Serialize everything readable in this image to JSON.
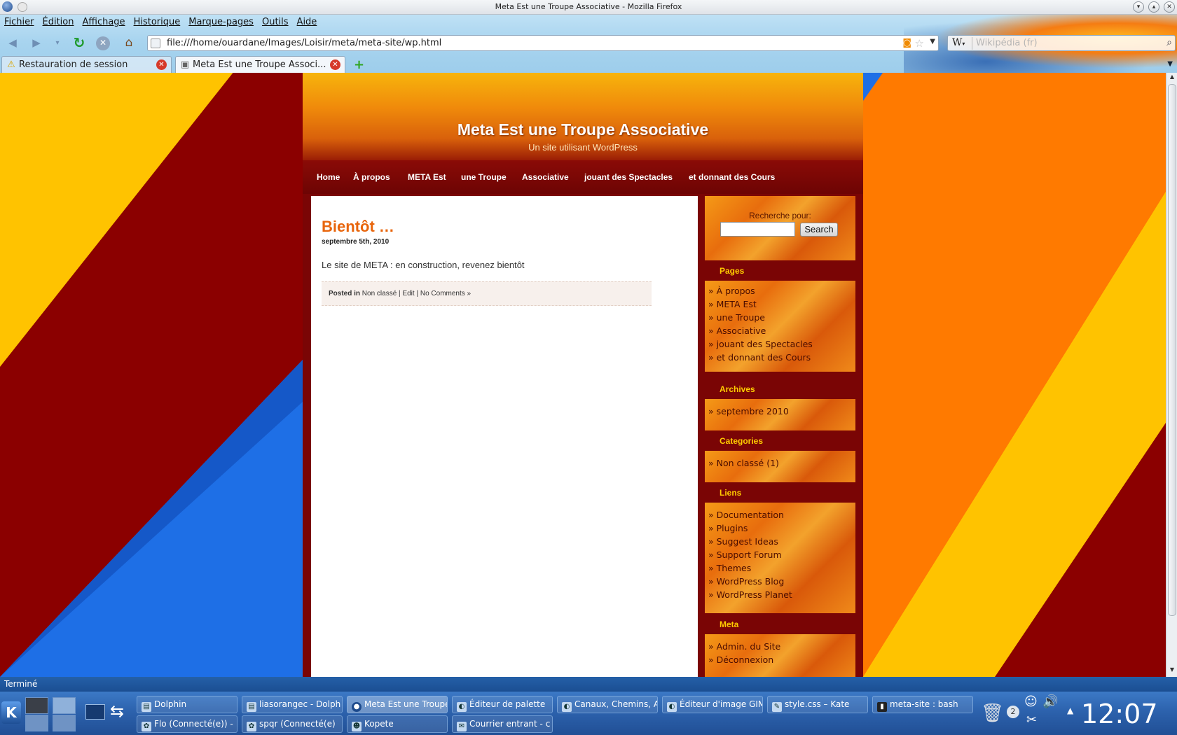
{
  "window": {
    "title": "Meta Est une Troupe Associative - Mozilla Firefox"
  },
  "menubar": [
    "Fichier",
    "Édition",
    "Affichage",
    "Historique",
    "Marque-pages",
    "Outils",
    "Aide"
  ],
  "navbar": {
    "url": "file:///home/ouardane/Images/Loisir/meta/meta-site/wp.html",
    "search_engine": "W",
    "search_placeholder": "Wikipédia (fr)"
  },
  "tabs": [
    {
      "label": "Restauration de session",
      "icon": "warning-icon",
      "active": false
    },
    {
      "label": "Meta Est une Troupe Associ...",
      "icon": "page-icon",
      "active": true
    }
  ],
  "site": {
    "title": "Meta Est une Troupe Associative",
    "description": "Un site utilisant WordPress",
    "nav": [
      "Home",
      "À propos",
      "META Est",
      "une Troupe",
      "Associative",
      "jouant des Spectacles",
      "et donnant des Cours"
    ],
    "post": {
      "title": "Bientôt …",
      "date": "septembre 5th, 2010",
      "body": "Le site de META : en construction, revenez bientôt",
      "meta_prefix": "Posted in",
      "category": "Non classé",
      "sep1": "|",
      "edit": "Edit",
      "sep2": "|",
      "comments": "No Comments »"
    },
    "sidebar": {
      "search_label": "Recherche pour:",
      "search_button": "Search",
      "pages_title": "Pages",
      "pages": [
        "» À propos",
        "» META Est",
        "» une Troupe",
        "» Associative",
        "» jouant des Spectacles",
        "» et donnant des Cours"
      ],
      "archives_title": "Archives",
      "archives": [
        "» septembre 2010"
      ],
      "categories_title": "Categories",
      "categories": [
        "» Non classé (1)"
      ],
      "links_title": "Liens",
      "links": [
        "» Documentation",
        "» Plugins",
        "» Suggest Ideas",
        "» Support Forum",
        "» Themes",
        "» WordPress Blog",
        "» WordPress Planet"
      ],
      "meta_title": "Meta",
      "meta": [
        "» Admin. du Site",
        "» Déconnexion"
      ]
    }
  },
  "status": "Terminé",
  "taskbar": {
    "row1": [
      "Dolphin",
      "liasorangec - Dolph",
      "Meta Est une Troupe",
      "Éditeur de palette",
      "Canaux, Chemins, A",
      "Éditeur d'image GIM",
      "style.css – Kate",
      "meta-site : bash"
    ],
    "row2": [
      "Flo (Connecté(e)) -",
      "spqr (Connecté(e)",
      "Kopete",
      "Courrier entrant - c"
    ],
    "active": "Meta Est une Troupe",
    "clock": "12:07",
    "tray_badge": "2"
  },
  "colors": {
    "brand_orange": "#e8650c",
    "dark_red": "#7a0505",
    "sidebar_heading": "#ffcc00",
    "taskbar_blue": "#2c62ad"
  }
}
